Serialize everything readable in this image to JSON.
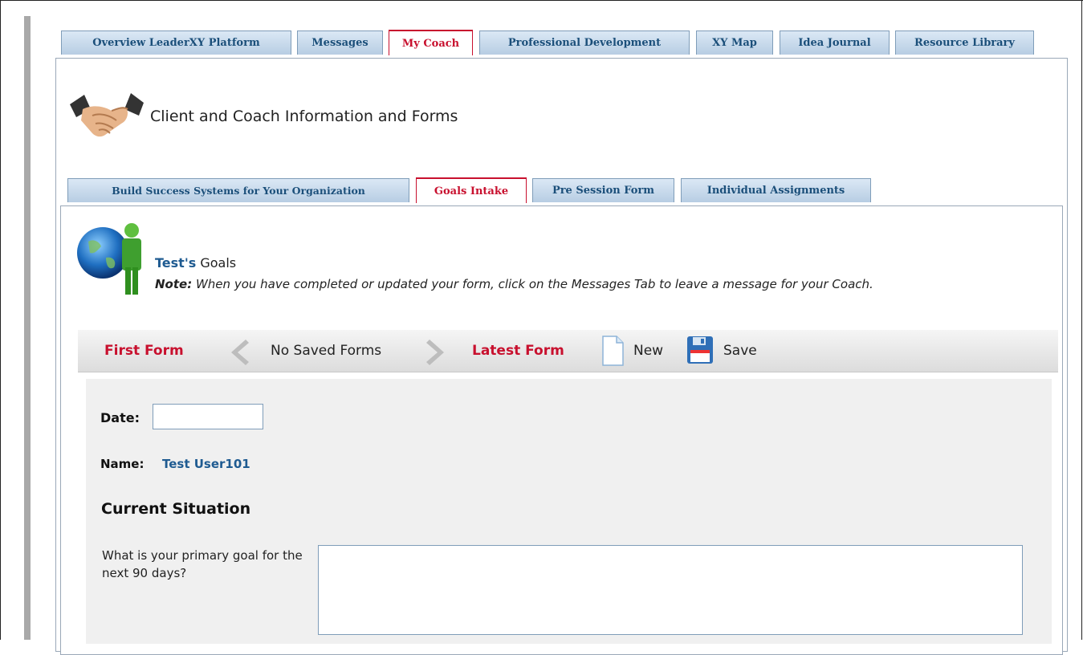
{
  "main_tabs": [
    {
      "label": "Overview LeaderXY Platform",
      "active": false
    },
    {
      "label": "Messages",
      "active": false
    },
    {
      "label": "My Coach",
      "active": true
    },
    {
      "label": "Professional Development",
      "active": false
    },
    {
      "label": "XY Map",
      "active": false
    },
    {
      "label": "Idea Journal",
      "active": false
    },
    {
      "label": "Resource Library",
      "active": false
    }
  ],
  "header": {
    "icon": "handshake-icon",
    "title": "Client and Coach Information and Forms"
  },
  "sub_tabs": [
    {
      "label": "Build Success Systems for Your Organization",
      "active": false
    },
    {
      "label": "Goals Intake",
      "active": true
    },
    {
      "label": "Pre Session Form",
      "active": false
    },
    {
      "label": "Individual Assignments",
      "active": false
    }
  ],
  "goals": {
    "icon": "globe-person-icon",
    "owner": "Test's",
    "title_suffix": " Goals",
    "note_label": "Note:",
    "note_text": " When you have completed or updated your form, click on the Messages Tab to leave a message for your Coach."
  },
  "toolbar": {
    "first_form": "First Form",
    "status": "No Saved Forms",
    "latest_form": "Latest Form",
    "new_label": "New",
    "save_label": "Save",
    "prev_icon": "chevron-left-icon",
    "next_icon": "chevron-right-icon",
    "new_icon": "document-icon",
    "save_icon": "floppy-disk-icon"
  },
  "form": {
    "date_label": "Date:",
    "date_value": "",
    "name_label": "Name:",
    "name_value": "Test User101",
    "section_title": "Current Situation",
    "question_1": "What is your primary goal for the next 90 days?",
    "answer_1": ""
  }
}
